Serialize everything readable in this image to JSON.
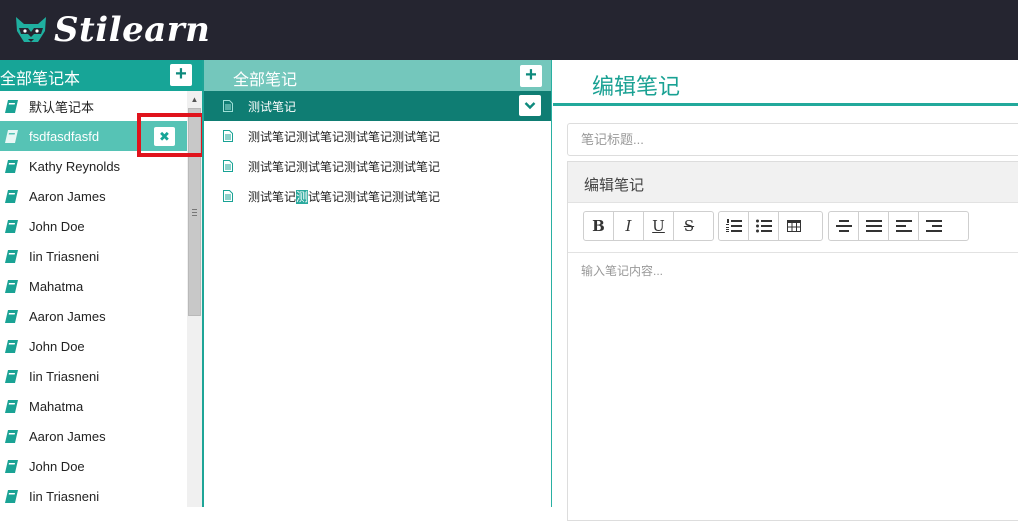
{
  "app": {
    "logo_text": "Stilearn"
  },
  "notebooks": {
    "header": "全部笔记本",
    "add_label": "+",
    "delete_label": "✖",
    "items": [
      {
        "label": "默认笔记本"
      },
      {
        "label": "fsdfasdfasfd",
        "selected": true
      },
      {
        "label": "Kathy Reynolds"
      },
      {
        "label": "Aaron James"
      },
      {
        "label": "John Doe"
      },
      {
        "label": "Iin Triasneni"
      },
      {
        "label": "Mahatma"
      },
      {
        "label": "Aaron James"
      },
      {
        "label": "John Doe"
      },
      {
        "label": "Iin Triasneni"
      },
      {
        "label": "Mahatma"
      },
      {
        "label": "Aaron James"
      },
      {
        "label": "John Doe"
      },
      {
        "label": "Iin Triasneni"
      }
    ]
  },
  "notes": {
    "header": "全部笔记",
    "add_label": "+",
    "items": [
      {
        "label": "测试笔记",
        "selected": true
      },
      {
        "label": "测试笔记测试笔记测试笔记测试笔记"
      },
      {
        "label": "测试笔记测试笔记测试笔记测试笔记"
      },
      {
        "label_pre": "测试笔记",
        "label_hl": "测",
        "label_post": "试笔记测试笔记测试笔记"
      }
    ]
  },
  "editor": {
    "title": "编辑笔记",
    "title_placeholder": "笔记标题...",
    "panel_title": "编辑笔记",
    "content_placeholder": "输入笔记内容...",
    "toolbar": {
      "bold": "B",
      "italic": "I",
      "underline": "U",
      "strike": "S"
    }
  },
  "colors": {
    "topbar": "#252530",
    "accent": "#17a597",
    "notes_header": "#74c7bc",
    "selected_note": "#0f7d73",
    "selected_notebook": "#56c3b5",
    "highlight_box": "#e0131c"
  },
  "icons": {
    "logo": "raccoon-icon",
    "notebook": "book-icon",
    "note": "document-icon",
    "add": "plus-icon",
    "delete": "close-icon",
    "expand": "chevron-down-icon"
  }
}
